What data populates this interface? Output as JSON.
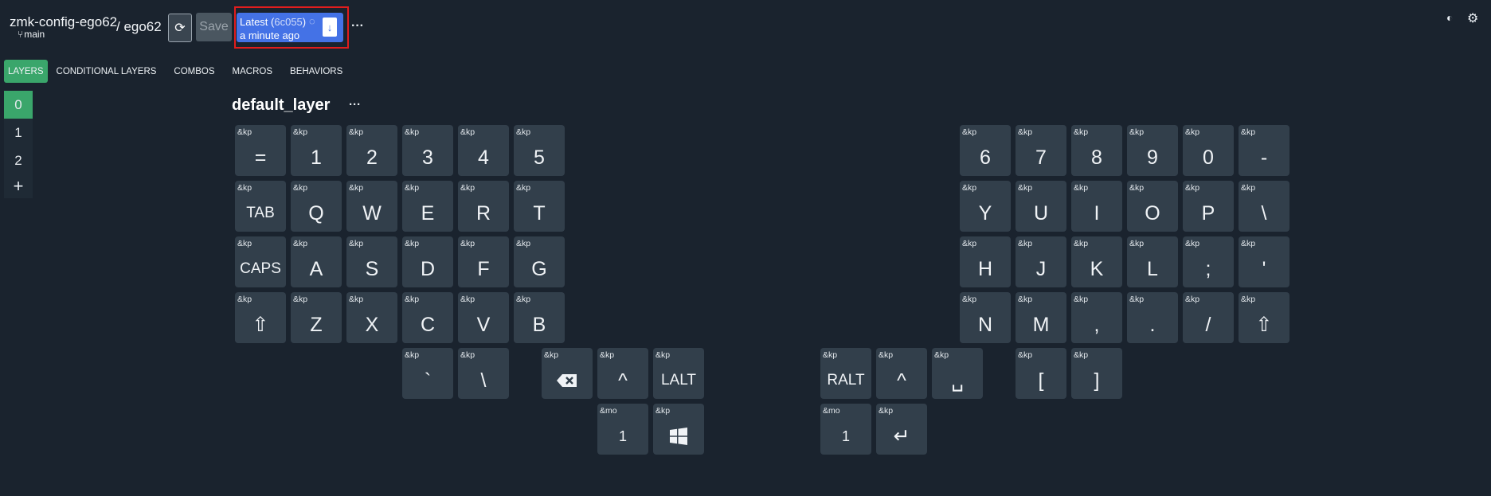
{
  "header": {
    "repo": "zmk-config-ego62",
    "branch": "main",
    "board": "/ ego62",
    "save_label": "Save",
    "build_line1": "Latest (",
    "build_sha": "6c055",
    "build_close": ")",
    "build_time": "a minute ago",
    "more": "···"
  },
  "tabs": [
    "LAYERS",
    "CONDITIONAL LAYERS",
    "COMBOS",
    "MACROS",
    "BEHAVIORS"
  ],
  "layers": [
    "0",
    "1",
    "2"
  ],
  "layer_add": "+",
  "layer_title": "default_layer",
  "layer_more": "···",
  "keys": [
    {
      "b": "&kp",
      "p": "="
    },
    {
      "b": "&kp",
      "p": "1"
    },
    {
      "b": "&kp",
      "p": "2"
    },
    {
      "b": "&kp",
      "p": "3"
    },
    {
      "b": "&kp",
      "p": "4"
    },
    {
      "b": "&kp",
      "p": "5"
    },
    {
      "b": "&kp",
      "p": "6"
    },
    {
      "b": "&kp",
      "p": "7"
    },
    {
      "b": "&kp",
      "p": "8"
    },
    {
      "b": "&kp",
      "p": "9"
    },
    {
      "b": "&kp",
      "p": "0"
    },
    {
      "b": "&kp",
      "p": "-"
    },
    {
      "b": "&kp",
      "p": "TAB",
      "sz": "sm"
    },
    {
      "b": "&kp",
      "p": "Q"
    },
    {
      "b": "&kp",
      "p": "W"
    },
    {
      "b": "&kp",
      "p": "E"
    },
    {
      "b": "&kp",
      "p": "R"
    },
    {
      "b": "&kp",
      "p": "T"
    },
    {
      "b": "&kp",
      "p": "Y"
    },
    {
      "b": "&kp",
      "p": "U"
    },
    {
      "b": "&kp",
      "p": "I"
    },
    {
      "b": "&kp",
      "p": "O"
    },
    {
      "b": "&kp",
      "p": "P"
    },
    {
      "b": "&kp",
      "p": "\\"
    },
    {
      "b": "&kp",
      "p": "CAPS",
      "sz": "sm"
    },
    {
      "b": "&kp",
      "p": "A"
    },
    {
      "b": "&kp",
      "p": "S"
    },
    {
      "b": "&kp",
      "p": "D"
    },
    {
      "b": "&kp",
      "p": "F"
    },
    {
      "b": "&kp",
      "p": "G"
    },
    {
      "b": "&kp",
      "p": "H"
    },
    {
      "b": "&kp",
      "p": "J"
    },
    {
      "b": "&kp",
      "p": "K"
    },
    {
      "b": "&kp",
      "p": "L"
    },
    {
      "b": "&kp",
      "p": ";"
    },
    {
      "b": "&kp",
      "p": "'"
    },
    {
      "b": "&kp",
      "p": "⇧"
    },
    {
      "b": "&kp",
      "p": "Z"
    },
    {
      "b": "&kp",
      "p": "X"
    },
    {
      "b": "&kp",
      "p": "C"
    },
    {
      "b": "&kp",
      "p": "V"
    },
    {
      "b": "&kp",
      "p": "B"
    },
    {
      "b": "&kp",
      "p": "N"
    },
    {
      "b": "&kp",
      "p": "M"
    },
    {
      "b": "&kp",
      "p": ","
    },
    {
      "b": "&kp",
      "p": "."
    },
    {
      "b": "&kp",
      "p": "/"
    },
    {
      "b": "&kp",
      "p": "⇧"
    },
    {
      "b": "&kp",
      "p": "`"
    },
    {
      "b": "&kp",
      "p": "\\"
    },
    {
      "b": "&kp",
      "p": "",
      "icon": "backspace-icon"
    },
    {
      "b": "&kp",
      "p": "^"
    },
    {
      "b": "&kp",
      "p": "LALT",
      "sz": "sm"
    },
    {
      "b": "&kp",
      "p": "RALT",
      "sz": "sm"
    },
    {
      "b": "&kp",
      "p": "^"
    },
    {
      "b": "&kp",
      "p": "␣"
    },
    {
      "b": "&kp",
      "p": "["
    },
    {
      "b": "&kp",
      "p": "]"
    },
    {
      "b": "&mo",
      "p": "1",
      "sz": "xs"
    },
    {
      "b": "&kp",
      "p": "",
      "icon": "windows-icon"
    },
    {
      "b": "&mo",
      "p": "1",
      "sz": "xs"
    },
    {
      "b": "&kp",
      "p": "↵"
    }
  ],
  "colors": {
    "background": "#1a232e",
    "key": "#323f4b",
    "accent": "#3aa66b",
    "build": "#4472e6",
    "highlight": "#e11d1d"
  },
  "icons": {
    "sync": "refresh-icon",
    "download": "file-download-icon",
    "theme": "contrast-icon",
    "settings": "gear-icon",
    "branch": "git-branch-icon"
  }
}
